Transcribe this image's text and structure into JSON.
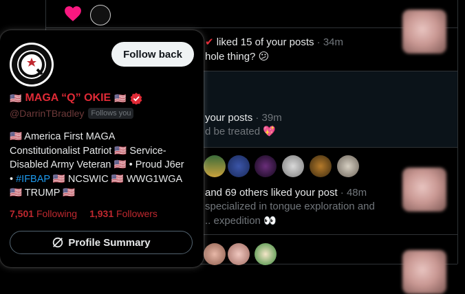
{
  "notifications": [
    {
      "text": "liked 15 of your posts",
      "time": "34m",
      "subtext": "hole thing? 😕"
    },
    {
      "text": "your posts",
      "time": "39m",
      "subtext": "d be treated 💖"
    },
    {
      "text": "and 69 others liked your post",
      "time": "48m",
      "lines": [
        "specialized in tongue exploration and",
        ".. expedition 👀"
      ]
    }
  ],
  "hover_card": {
    "follow_button": "Follow back",
    "display_name": "MAGA “Q” OKIE",
    "handle": "@DarrinTBradley",
    "follows_you": "Follows you",
    "bio_lines": [
      "🇺🇸 America First MAGA",
      "Constitutionalist Patriot 🇺🇸 Service-",
      "Disabled Army Veteran 🇺🇸 • Proud J6er",
      "• ",
      "#IFBAP",
      " 🇺🇸 NCSWIC 🇺🇸 WWG1WGA",
      "🇺🇸 TRUMP 🇺🇸"
    ],
    "following_count": "7,501",
    "following_label": "Following",
    "followers_count": "1,931",
    "followers_label": "Followers",
    "summary_button": "Profile Summary"
  },
  "colors": {
    "accent_red": "#e02a36",
    "link_blue": "#1d9bf0",
    "heart_pink": "#f91880"
  }
}
